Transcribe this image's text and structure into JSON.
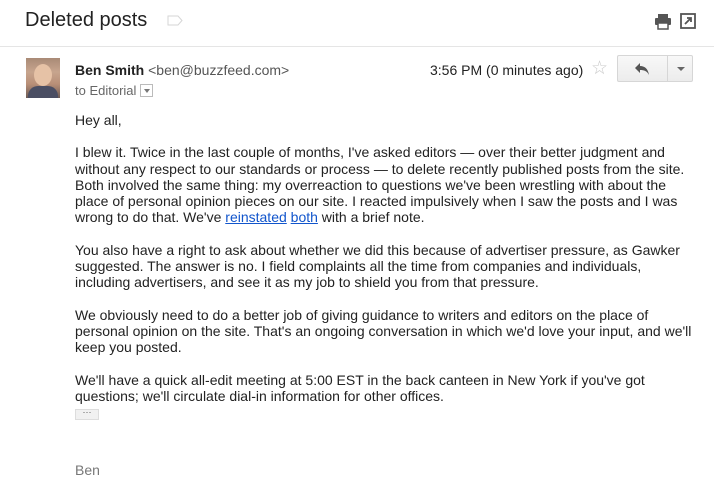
{
  "subject": "Deleted posts",
  "icons": {
    "label": "label-tag-icon",
    "print": "print-icon",
    "popout": "new-window-icon",
    "star": "star-icon",
    "reply": "reply-icon",
    "more": "dropdown-arrow-icon",
    "to_details": "show-details-arrow-icon",
    "trimmed": "show-trimmed-content-icon"
  },
  "message": {
    "sender_name": "Ben Smith",
    "sender_email": "<ben@buzzfeed.com>",
    "to": "to Editorial",
    "time": "3:56 PM (0 minutes ago)",
    "star_glyph": "☆",
    "trimmed_glyph": "···",
    "body": {
      "greeting": "Hey all,",
      "p1_before_links": "I blew it. Twice in the last couple of months, I've asked editors — over their better judgment and without any respect to our standards or process — to delete recently published posts from the site. Both involved the same thing: my overreaction to questions we've been wrestling with about the place of personal opinion pieces on our site. I reacted impulsively when I saw the posts and I was wrong to do that. We've ",
      "link1": "reinstated",
      "link2": "both",
      "p1_after_links": " with a brief note.",
      "p2": "You also have a right to ask about whether we did this because of advertiser pressure, as Gawker suggested. The answer is no. I field complaints all the time from companies and individuals, including advertisers, and see it as my job to shield you from that pressure.",
      "p3": "We obviously need to do a better job of giving guidance to writers and editors on the place of personal opinion on the site. That's an ongoing conversation in which we'd love your input, and we'll keep you posted.",
      "p4": "We'll have a quick all-edit meeting at 5:00 EST in the back canteen in New York if you've got questions; we'll circulate dial-in information for other offices."
    },
    "signature": "Ben"
  },
  "colors": {
    "link": "#1155cc",
    "star": "#c9c9c9",
    "text": "#222222"
  }
}
